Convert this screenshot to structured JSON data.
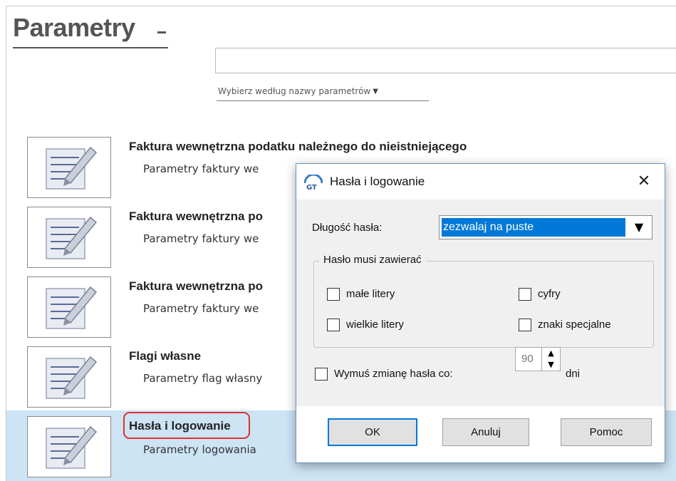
{
  "page": {
    "title": "Parametry",
    "search": {
      "value": "",
      "placeholder": ""
    },
    "filter_label": "Wybierz według nazwy parametrów"
  },
  "rows": [
    {
      "title": "Faktura wewnętrzna podatku należnego do nieistniejącego",
      "subtitle": "Parametry faktury we"
    },
    {
      "title": "Faktura wewnętrzna po",
      "subtitle": "Parametry faktury we"
    },
    {
      "title": "Faktura wewnętrzna po",
      "subtitle": "Parametry faktury we"
    },
    {
      "title": "Flagi własne",
      "subtitle": "Parametry flag własny"
    },
    {
      "title": "Hasła i logowanie",
      "subtitle": "Parametry logowania",
      "selected": true
    }
  ],
  "dialog": {
    "title": "Hasła i logowanie",
    "close_glyph": "✕",
    "password_length": {
      "label": "Długość hasła:",
      "selected": "zezwalaj na puste"
    },
    "group": {
      "legend": "Hasło musi zawierać",
      "lowercase": {
        "label": "małe litery",
        "checked": false
      },
      "digits": {
        "label": "cyfry",
        "checked": false
      },
      "uppercase": {
        "label": "wielkie litery",
        "checked": false
      },
      "special": {
        "label": "znaki specjalne",
        "checked": false
      }
    },
    "force_change": {
      "label": "Wymuś zmianę hasła co:",
      "checked": false,
      "value": "90",
      "unit": "dni"
    },
    "buttons": {
      "ok": "OK",
      "cancel": "Anuluj",
      "help": "Pomoc"
    }
  },
  "icons": {
    "dropdown": "chevron-down-icon",
    "row": "parameter-document-icon",
    "app": "app-logo-icon"
  },
  "colors": {
    "selection": "#cde4f5",
    "select_highlight": "#0078d7",
    "highlight_border": "#e03030"
  }
}
